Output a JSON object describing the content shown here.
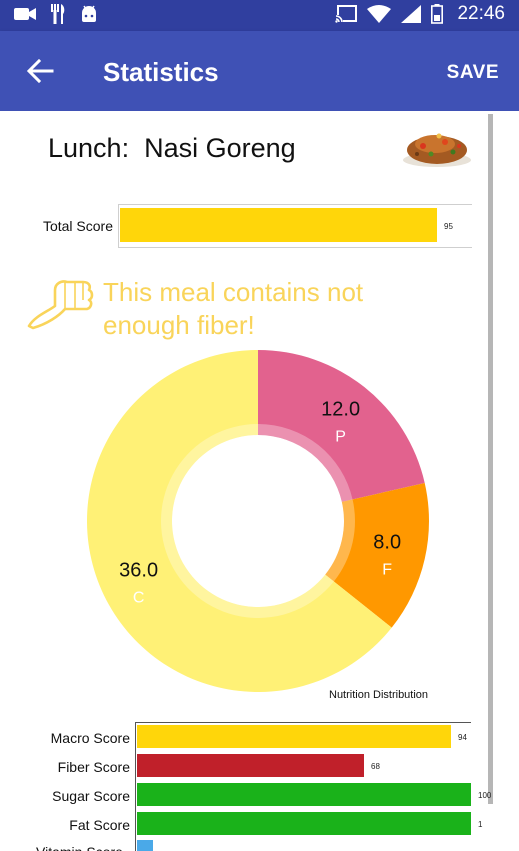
{
  "status_bar": {
    "time": "22:46",
    "left_icons": [
      "video-camera-icon",
      "restaurant-icon",
      "android-icon"
    ],
    "right_icons": [
      "cast-icon",
      "wifi-icon",
      "signal-icon",
      "battery-icon"
    ]
  },
  "app_bar": {
    "title": "Statistics",
    "action_label": "SAVE",
    "background": "#3f51b5"
  },
  "meal": {
    "type_label": "Lunch:",
    "name": "Nasi Goreng"
  },
  "total_score": {
    "label": "Total Score",
    "value": 95,
    "value_text": "95",
    "color": "#ffd60a"
  },
  "advice": {
    "text": "This meal contains not enough fiber!",
    "color": "#f9d45a",
    "icon": "thumbs-down-icon"
  },
  "chart_data": {
    "type": "pie",
    "title": "Nutrition Distribution",
    "slices": [
      {
        "label": "P",
        "value": 12.0,
        "value_text": "12.0",
        "color": "#e2628e"
      },
      {
        "label": "F",
        "value": 8.0,
        "value_text": "8.0",
        "color": "#ff9800"
      },
      {
        "label": "C",
        "value": 36.0,
        "value_text": "36.0",
        "color": "#fff176"
      }
    ]
  },
  "scores": [
    {
      "label": "Macro Score",
      "value": 94,
      "value_text": "94",
      "color": "#ffd60a"
    },
    {
      "label": "Fiber Score",
      "value": 68,
      "value_text": "68",
      "color": "#c0202a"
    },
    {
      "label": "Sugar Score",
      "value": 100,
      "value_text": "100",
      "color": "#1ab21a"
    },
    {
      "label": "Fat Score",
      "value": 100,
      "value_text": "1",
      "color": "#1ab21a"
    }
  ]
}
